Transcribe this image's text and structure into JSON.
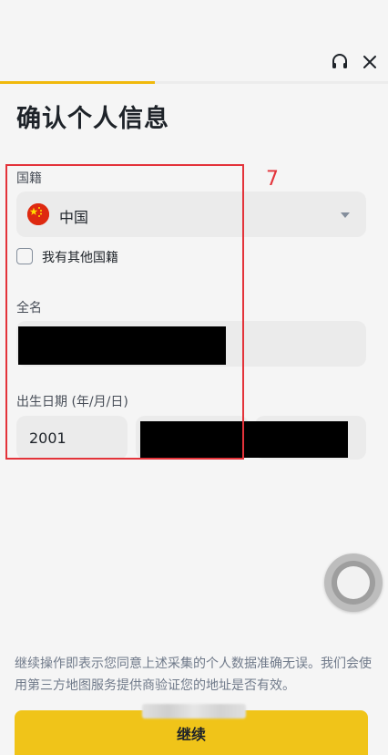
{
  "header": {
    "support_icon": "headset-icon",
    "close_icon": "close-icon",
    "progress": 0.4
  },
  "page": {
    "title": "确认个人信息"
  },
  "form": {
    "nationality": {
      "label": "国籍",
      "flag_icon": "china-flag-icon",
      "value": "中国"
    },
    "other_nationality": {
      "label": "我有其他国籍",
      "checked": false
    },
    "full_name": {
      "label": "全名"
    },
    "birth_date": {
      "label": "出生日期 (年/月/日)",
      "year": "2001"
    }
  },
  "annotation": {
    "number": "7",
    "color": "#e3333a"
  },
  "footer": {
    "disclaimer": "继续操作即表示您同意上述采集的个人数据准确无误。我们会使用第三方地图服务提供商验证您的地址是否有效。",
    "continue_label": "继续"
  },
  "colors": {
    "accent": "#f0b90b",
    "button": "#f0c419"
  }
}
